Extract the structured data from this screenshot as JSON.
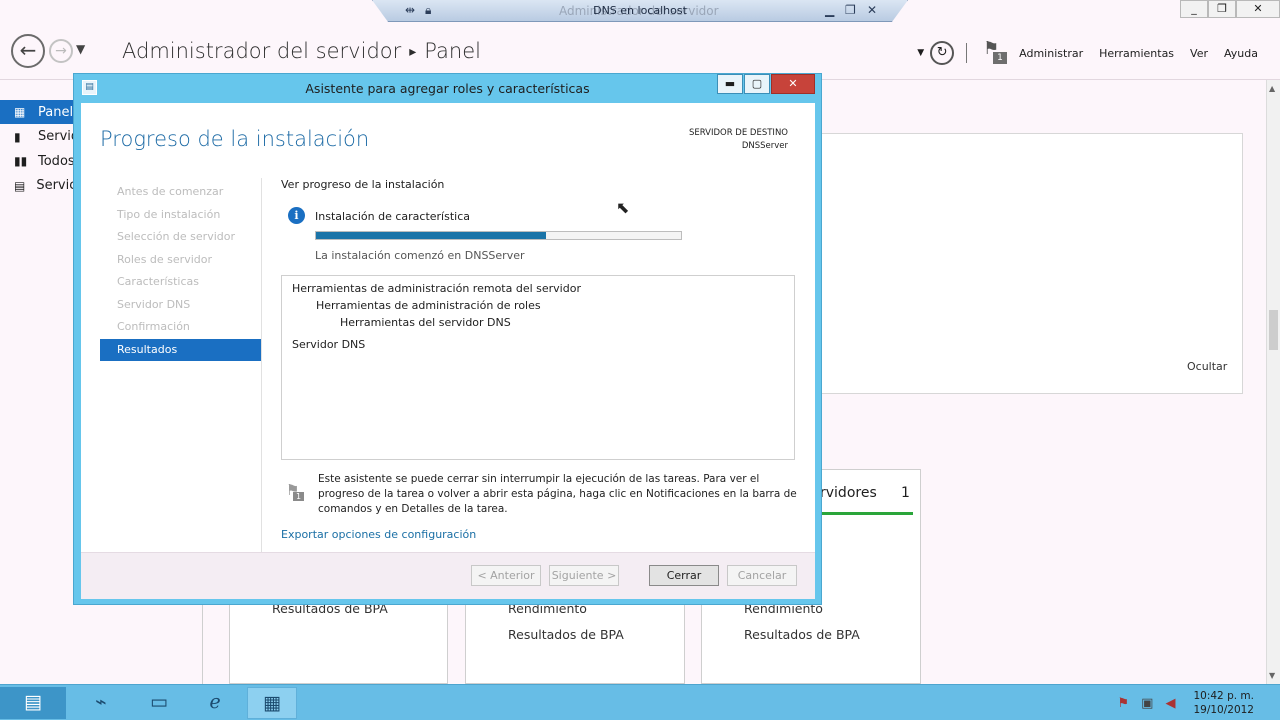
{
  "remote_bar": {
    "title": "DNS en localhost",
    "ghost_title": "Administrador del servidor"
  },
  "window_controls": {
    "minimize": "_",
    "restore": "❐",
    "close": "✕"
  },
  "server_manager": {
    "title": "Administrador del servidor",
    "page": "Panel",
    "notification_count": "1",
    "menus": [
      "Administrar",
      "Herramientas",
      "Ver",
      "Ayuda"
    ]
  },
  "sidebar": {
    "items": [
      {
        "label": "Panel",
        "icon": "dashboard-icon"
      },
      {
        "label": "Servid",
        "icon": "server-icon"
      },
      {
        "label": "Todos",
        "icon": "servers-icon"
      },
      {
        "label": "Servici",
        "icon": "role-icon"
      }
    ]
  },
  "background": {
    "hide_label": "Ocultar",
    "tile_title_partial": "rvidores",
    "tile_count": "1",
    "rows": {
      "bpa1": "Resultados de BPA",
      "perf1": "Rendimiento",
      "bpa2": "Resultados de BPA",
      "perf2": "Rendimiento",
      "bpa3": "Resultados de BPA"
    }
  },
  "wizard": {
    "title": "Asistente para agregar roles y características",
    "heading": "Progreso de la instalación",
    "destination_label": "SERVIDOR DE DESTINO",
    "destination_server": "DNSServer",
    "steps": [
      "Antes de comenzar",
      "Tipo de instalación",
      "Selección de servidor",
      "Roles de servidor",
      "Características",
      "Servidor DNS",
      "Confirmación",
      "Resultados"
    ],
    "active_step": 7,
    "view_progress_label": "Ver progreso de la instalación",
    "status": "Instalación de característica",
    "progress_fraction": 0.63,
    "started_message": "La instalación comenzó en DNSServer",
    "results": [
      {
        "text": "Herramientas de administración remota del servidor",
        "level": 0
      },
      {
        "text": "Herramientas de administración de roles",
        "level": 1
      },
      {
        "text": "Herramientas del servidor DNS",
        "level": 2
      },
      {
        "text": "Servidor DNS",
        "level": 0
      }
    ],
    "note_badge": "1",
    "note": "Este asistente se puede cerrar sin interrumpir la ejecución de las tareas. Para ver el progreso de la tarea o volver a abrir esta página, haga clic en Notificaciones en la barra de comandos y en Detalles de la tarea.",
    "export_link": "Exportar opciones de configuración",
    "buttons": {
      "previous": "< Anterior",
      "next": "Siguiente >",
      "close": "Cerrar",
      "cancel": "Cancelar"
    }
  },
  "taskbar": {
    "time": "10:42 p. m.",
    "date": "19/10/2012"
  }
}
